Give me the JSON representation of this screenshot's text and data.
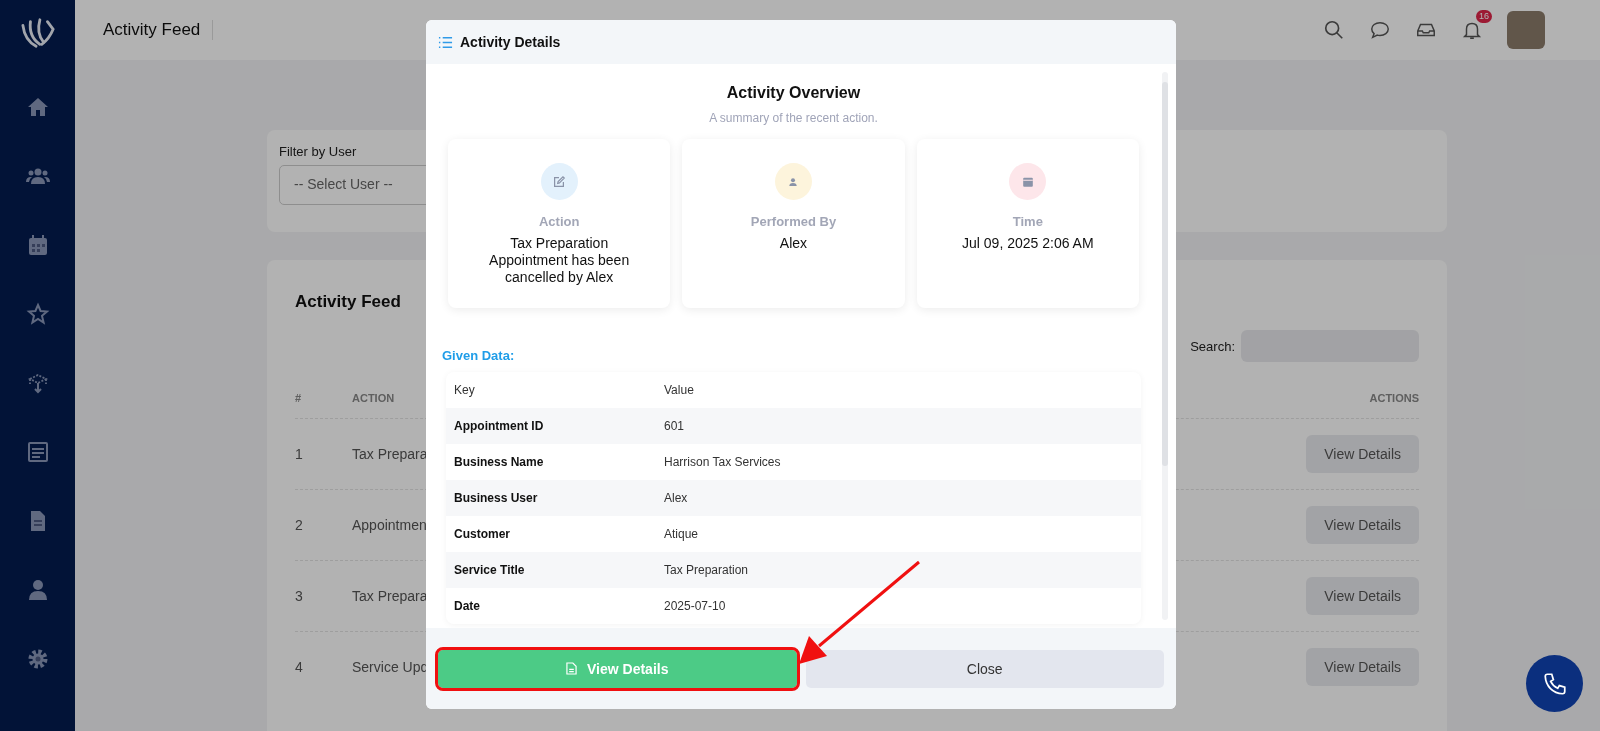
{
  "header": {
    "title": "Activity Feed",
    "notification_count": "16"
  },
  "filter": {
    "label": "Filter by User",
    "placeholder": "-- Select User --"
  },
  "feed": {
    "title": "Activity Feed",
    "search_label": "Search:",
    "columns": [
      "#",
      "ACTION",
      "ACTIONS"
    ],
    "rows": [
      {
        "number": "1",
        "action": "Tax Prepara",
        "button": "View Details"
      },
      {
        "number": "2",
        "action": "Appointmen",
        "button": "View Details"
      },
      {
        "number": "3",
        "action": "Tax Prepara",
        "button": "View Details"
      },
      {
        "number": "4",
        "action": "Service Upd",
        "button": "View Details"
      }
    ]
  },
  "modal": {
    "title": "Activity Details",
    "heading": "Activity Overview",
    "subtitle": "A summary of the recent action.",
    "cards": [
      {
        "kind": "action",
        "color": "#e3f1fc",
        "label": "Action",
        "value": "Tax Preparation Appointment has been cancelled by Alex"
      },
      {
        "kind": "user",
        "color": "#fdf4dc",
        "label": "Performed By",
        "value": "Alex"
      },
      {
        "kind": "time",
        "color": "#fde6ea",
        "label": "Time",
        "value": "Jul 09, 2025 2:06 AM"
      }
    ],
    "given_data_label": "Given Data:",
    "table": {
      "columns": [
        "Key",
        "Value"
      ],
      "rows": [
        [
          "Appointment ID",
          "601"
        ],
        [
          "Business Name",
          "Harrison Tax Services"
        ],
        [
          "Business User",
          "Alex"
        ],
        [
          "Customer",
          "Atique"
        ],
        [
          "Service Title",
          "Tax Preparation"
        ],
        [
          "Date",
          "2025-07-10"
        ]
      ]
    },
    "buttons": [
      {
        "kind": "primary",
        "label": "View Details",
        "highlighted": true
      },
      {
        "kind": "secondary",
        "label": "Close",
        "highlighted": false
      }
    ]
  }
}
